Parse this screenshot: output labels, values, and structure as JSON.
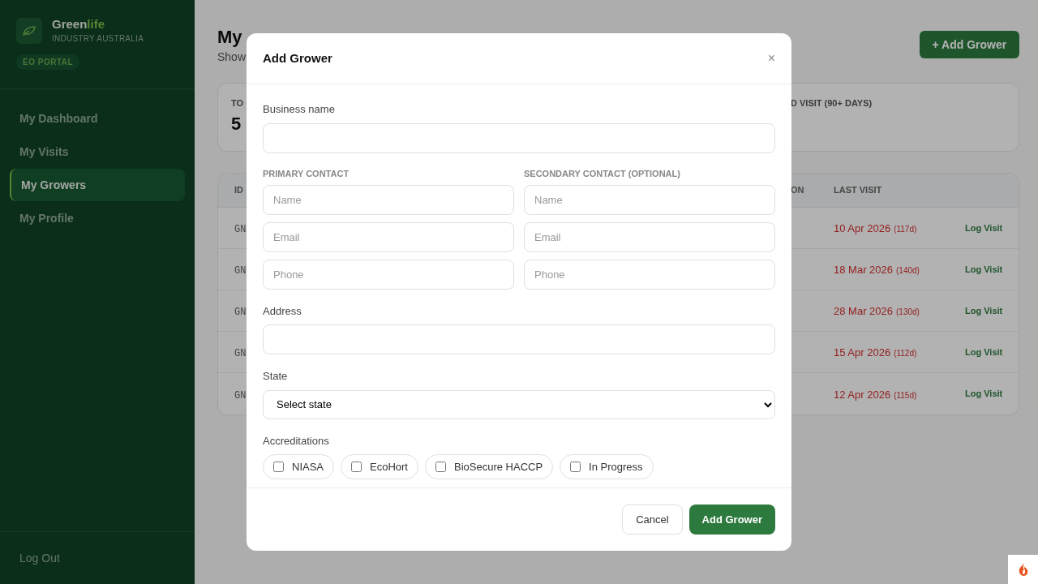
{
  "brand": {
    "name_main": "Green",
    "name_accent": "life",
    "subtitle": "INDUSTRY AUSTRALIA",
    "badge": "EO PORTAL"
  },
  "sidebar": {
    "items": [
      {
        "label": "My Dashboard",
        "selected": false
      },
      {
        "label": "My Visits",
        "selected": false
      },
      {
        "label": "My Growers",
        "selected": true
      },
      {
        "label": "My Profile",
        "selected": false
      }
    ],
    "logout": "Log Out"
  },
  "page": {
    "title": "My",
    "subtitle": "Show",
    "add_button": "+ Add Grower"
  },
  "stats": [
    {
      "label": "TO",
      "value": "5"
    },
    {
      "label": "D VISIT (90+ DAYS)"
    }
  ],
  "table": {
    "columns": [
      "ID",
      "ON",
      "LAST VISIT"
    ],
    "rows": [
      {
        "id": "GN",
        "date": "10 Apr 2026",
        "days": "(117d)",
        "action": "Log Visit"
      },
      {
        "id": "GN",
        "date": "18 Mar 2026",
        "days": "(140d)",
        "action": "Log Visit"
      },
      {
        "id": "GN",
        "date": "28 Mar 2026",
        "days": "(130d)",
        "action": "Log Visit"
      },
      {
        "id": "GN",
        "date": "15 Apr 2026",
        "days": "(112d)",
        "action": "Log Visit"
      },
      {
        "id": "GN",
        "date": "12 Apr 2026",
        "days": "(115d)",
        "action": "Log Visit"
      }
    ]
  },
  "modal": {
    "title": "Add Grower",
    "close": "×",
    "business_label": "Business name",
    "contacts": [
      {
        "heading": "PRIMARY CONTACT",
        "fields": [
          {
            "placeholder": "Name"
          },
          {
            "placeholder": "Email"
          },
          {
            "placeholder": "Phone"
          }
        ]
      },
      {
        "heading": "SECONDARY CONTACT (OPTIONAL)",
        "fields": [
          {
            "placeholder": "Name"
          },
          {
            "placeholder": "Email"
          },
          {
            "placeholder": "Phone"
          }
        ]
      }
    ],
    "address_label": "Address",
    "state_label": "State",
    "state_value": "Select state",
    "accreditations_label": "Accreditations",
    "accreditations": [
      {
        "label": "NIASA",
        "checked": false
      },
      {
        "label": "EcoHort",
        "checked": false
      },
      {
        "label": "BioSecure HACCP",
        "checked": false
      },
      {
        "label": "In Progress",
        "checked": false
      }
    ],
    "cancel": "Cancel",
    "submit": "Add Grower"
  }
}
